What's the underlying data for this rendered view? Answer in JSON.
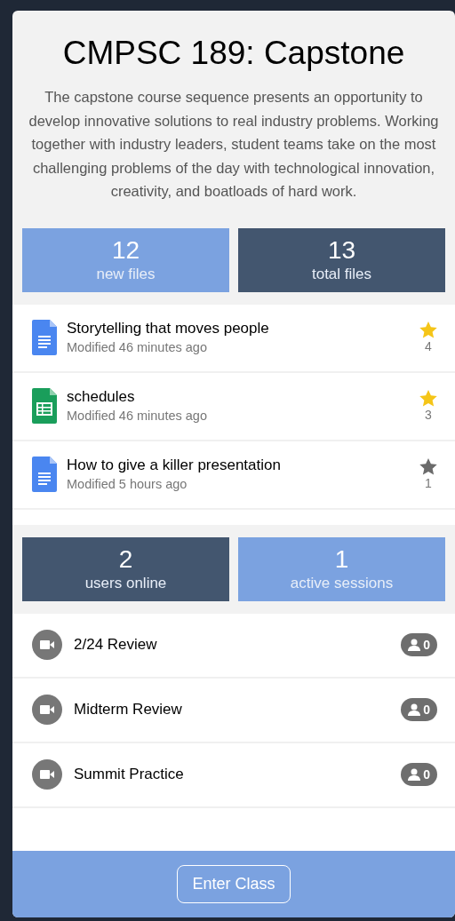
{
  "course": {
    "title": "CMPSC 189: Capstone",
    "description": "The capstone course sequence presents an opportunity to develop innovative solutions to real industry problems. Working together with industry leaders, student teams take on the most challenging problems of the day with technological innovation, creativity, and boatloads of hard work."
  },
  "file_stats": [
    {
      "value": "12",
      "label": "new files",
      "color": "#7ba2e0"
    },
    {
      "value": "13",
      "label": "total files",
      "color": "#43566f"
    }
  ],
  "files": [
    {
      "kind": "doc",
      "name": "Storytelling that moves people",
      "modified": "Modified 46 minutes ago",
      "starred": true,
      "star_count": "4"
    },
    {
      "kind": "sheet",
      "name": "schedules",
      "modified": "Modified 46 minutes ago",
      "starred": true,
      "star_count": "3"
    },
    {
      "kind": "doc",
      "name": "How to give a killer presentation",
      "modified": "Modified 5 hours ago",
      "starred": false,
      "star_count": "1"
    }
  ],
  "session_stats": [
    {
      "value": "2",
      "label": "users online",
      "color": "#43566f"
    },
    {
      "value": "1",
      "label": "active sessions",
      "color": "#7ba2e0"
    }
  ],
  "sessions": [
    {
      "name": "2/24 Review",
      "users": "0"
    },
    {
      "name": "Midterm Review",
      "users": "0"
    },
    {
      "name": "Summit Practice",
      "users": "0"
    }
  ],
  "footer": {
    "button": "Enter Class"
  }
}
